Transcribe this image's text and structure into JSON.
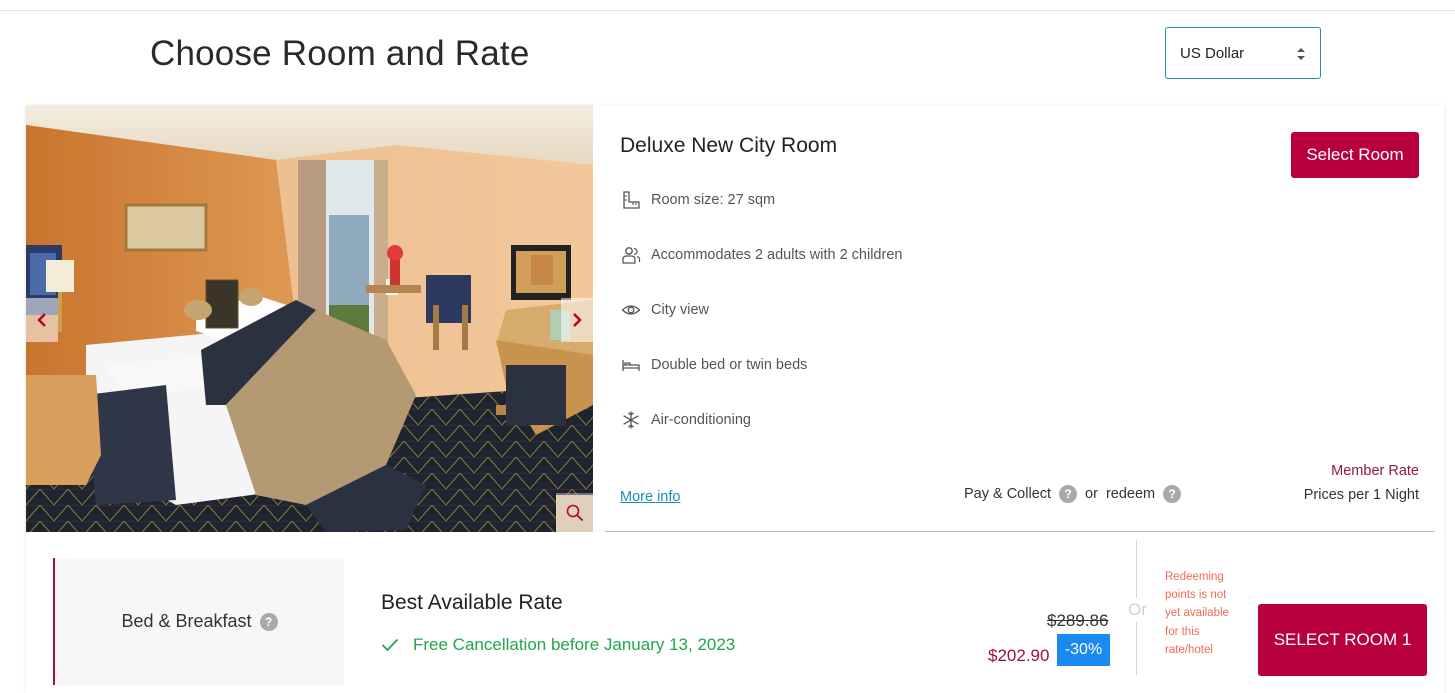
{
  "page": {
    "title": "Choose Room and Rate",
    "currency": {
      "selected": "US Dollar"
    }
  },
  "room": {
    "name": "Deluxe New City Room",
    "select_label": "Select Room",
    "features": [
      {
        "icon": "room-size-icon",
        "text": "Room size: 27 sqm"
      },
      {
        "icon": "people-icon",
        "text": "Accommodates 2 adults with 2 children"
      },
      {
        "icon": "eye-icon",
        "text": "City view"
      },
      {
        "icon": "bed-icon",
        "text": "Double bed or twin beds"
      },
      {
        "icon": "snowflake-icon",
        "text": "Air-conditioning"
      }
    ],
    "more_info": "More info",
    "pay_collect": "Pay & Collect",
    "or": "or",
    "redeem": "redeem",
    "member_rate": "Member Rate",
    "prices_per": "Prices per 1 Night"
  },
  "rate": {
    "board": "Bed & Breakfast",
    "name": "Best Available Rate",
    "cancellation": "Free Cancellation before January 13, 2023",
    "old_price": "$289.86",
    "new_price": "$202.90",
    "discount": "-30%",
    "or": "Or",
    "redeem_note": "Redeeming points is not yet available for this rate/hotel",
    "select_label": "SELECT ROOM 1"
  },
  "colors": {
    "brand": "#b7003d",
    "link": "#1b8fb5",
    "success": "#1fa84a",
    "discount": "#1a8af0",
    "warning": "#f26a55"
  }
}
